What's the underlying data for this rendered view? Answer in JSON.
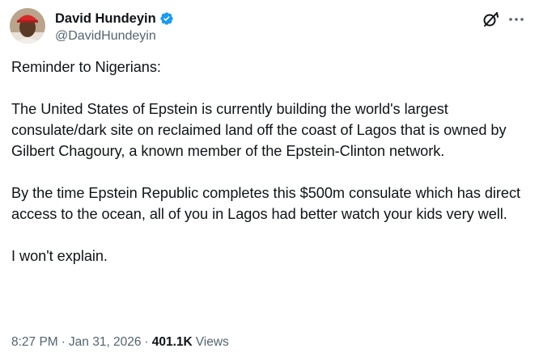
{
  "author": {
    "display_name": "David Hundeyin",
    "handle": "@DavidHundeyin",
    "verified": true,
    "avatar_icon": "profile-photo"
  },
  "actions": {
    "grok_icon": "grok-icon",
    "more_icon": "more-icon"
  },
  "tweet": {
    "paragraphs": [
      "Reminder to Nigerians:",
      "The United States of Epstein is currently building the world's largest consulate/dark site on reclaimed land off the coast of Lagos that is owned by Gilbert Chagoury, a known member of the Epstein-Clinton network.",
      "By the time Epstein Republic completes this $500m consulate which has direct access to the ocean, all of you in Lagos had better watch your kids very well.",
      "I won't explain."
    ]
  },
  "meta": {
    "time": "8:27 PM",
    "date": "Jan 31, 2026",
    "separator": "·",
    "views_count": "401.1K",
    "views_label": "Views"
  },
  "colors": {
    "text_primary": "#0f1419",
    "text_secondary": "#536471",
    "verified_blue": "#1d9bf0"
  }
}
